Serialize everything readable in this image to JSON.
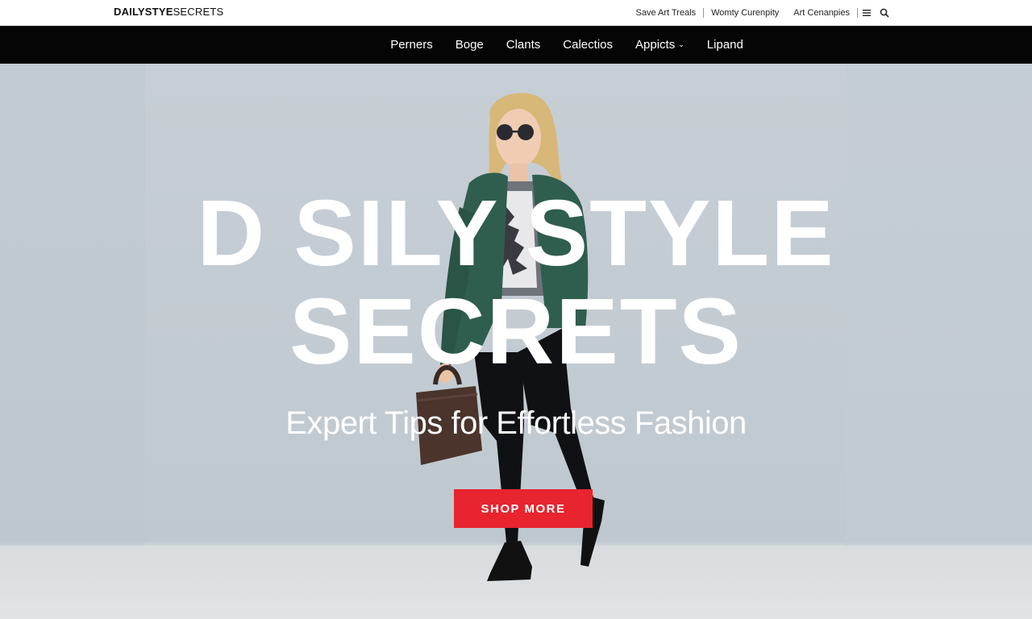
{
  "brand": {
    "name_bold": "DAILYSTYE",
    "name_thin": "SECRETS"
  },
  "utility_nav": {
    "links": [
      "Save Art Treals",
      "Womty Curenpity",
      "Art Cenanpies"
    ]
  },
  "main_nav": {
    "items": [
      "Perners",
      "Boge",
      "Clants",
      "Calectios",
      "Appicts",
      "Lipand"
    ],
    "dropdown_item_index": 4
  },
  "hero": {
    "headline_line1": "D SILY STYLE",
    "headline_line2": "SECRETS",
    "subtitle": "Expert Tips for Effortless Fashion",
    "cta_label": "SHOP MORE"
  },
  "icons": {
    "utility": [
      "menu-icon",
      "search-icon"
    ],
    "nav_dropdown": "chevron-down-icon"
  },
  "colors": {
    "nav_background": "#050505",
    "hero_background": "#c7ced5",
    "cta_background": "#e8242f",
    "jacket": "#2f5e4e"
  }
}
